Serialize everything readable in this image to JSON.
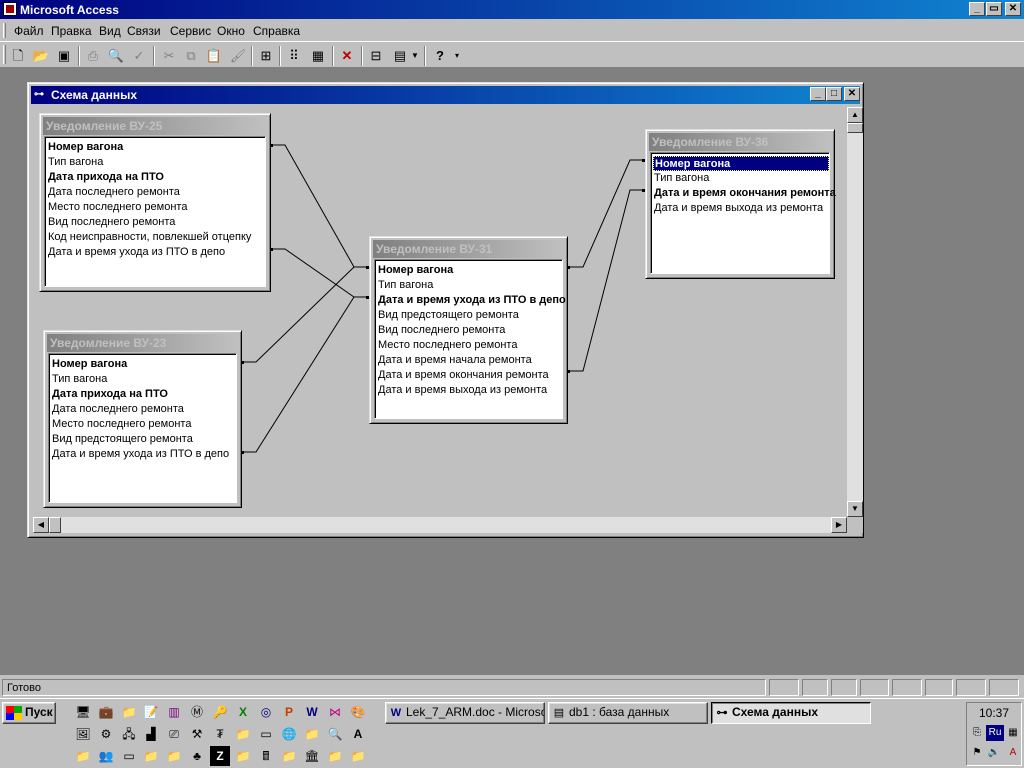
{
  "app": {
    "title": "Microsoft Access",
    "min": "_",
    "max": "▭",
    "close": "✕"
  },
  "menu": [
    "Файл",
    "Правка",
    "Вид",
    "Связи",
    "Сервис",
    "Окно",
    "Справка"
  ],
  "toolbar_icons": [
    "new-icon",
    "open-icon",
    "save-icon",
    "print-icon",
    "print-preview-icon",
    "spelling-icon",
    "cut-icon",
    "copy-icon",
    "paste-icon",
    "format-painter-icon",
    "show-table-icon",
    "show-direct-icon",
    "show-all-icon",
    "delete-icon",
    "database-window-icon",
    "new-object-icon",
    "help-icon"
  ],
  "child": {
    "title": "Схема данных",
    "min": "_",
    "max": "□",
    "close": "✕"
  },
  "tables": [
    {
      "name": "Уведомление ВУ-25",
      "fields": [
        {
          "text": "Номер вагона",
          "key": true
        },
        {
          "text": "Тип вагона",
          "key": false
        },
        {
          "text": "Дата прихода на ПТО",
          "key": true
        },
        {
          "text": "Дата последнего ремонта",
          "key": false
        },
        {
          "text": "Место последнего ремонта",
          "key": false
        },
        {
          "text": "Вид последнего ремонта",
          "key": false
        },
        {
          "text": "Код неисправности, повлекшей отцепку",
          "key": false
        },
        {
          "text": "Дата и время ухода из ПТО в депо",
          "key": false
        }
      ]
    },
    {
      "name": "Уведомление ВУ-23",
      "fields": [
        {
          "text": "Номер вагона",
          "key": true
        },
        {
          "text": "Тип вагона",
          "key": false
        },
        {
          "text": "Дата прихода на ПТО",
          "key": true
        },
        {
          "text": "Дата последнего ремонта",
          "key": false
        },
        {
          "text": "Место последнего ремонта",
          "key": false
        },
        {
          "text": "Вид предстоящего ремонта",
          "key": false
        },
        {
          "text": "Дата и время ухода из ПТО в депо",
          "key": false
        }
      ]
    },
    {
      "name": "Уведомление ВУ-31",
      "fields": [
        {
          "text": "Номер вагона",
          "key": true
        },
        {
          "text": "Тип вагона",
          "key": false
        },
        {
          "text": "Дата и время ухода из ПТО в депо",
          "key": true
        },
        {
          "text": "Вид предстоящего ремонта",
          "key": false
        },
        {
          "text": "Вид последнего ремонта",
          "key": false
        },
        {
          "text": "Место последнего ремонта",
          "key": false
        },
        {
          "text": "Дата и время начала ремонта",
          "key": false
        },
        {
          "text": "Дата и время окончания ремонта",
          "key": false
        },
        {
          "text": "Дата и время выхода из ремонта",
          "key": false
        }
      ]
    },
    {
      "name": "Уведомление ВУ-36",
      "fields": [
        {
          "text": "Номер вагона",
          "key": true,
          "selected": true
        },
        {
          "text": "Тип вагона",
          "key": false
        },
        {
          "text": "Дата и время окончания ремонта",
          "key": true
        },
        {
          "text": "Дата и время выхода из ремонта",
          "key": false
        }
      ]
    }
  ],
  "status": {
    "text": "Готово"
  },
  "taskbar": {
    "start": "Пуск",
    "tasks": [
      {
        "label": "Lek_7_ARM.doc - Microso...",
        "icon": "word-doc-icon"
      },
      {
        "label": "db1 : база данных",
        "icon": "database-icon"
      },
      {
        "label": "Схема данных",
        "icon": "relationships-icon",
        "active": true
      }
    ],
    "clock": "10:37",
    "lang": "Ru"
  }
}
